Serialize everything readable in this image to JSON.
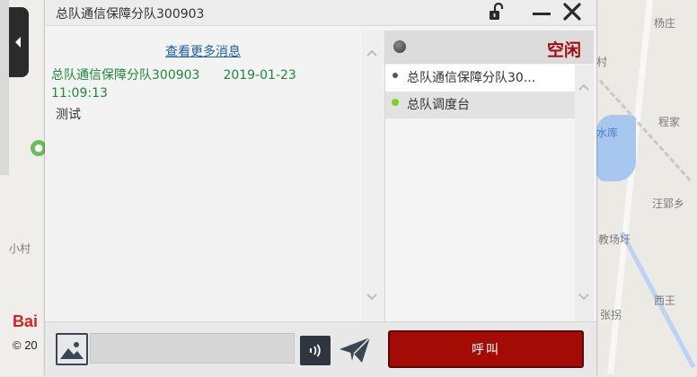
{
  "map": {
    "labels": [
      {
        "name": "map-label-yangzhuang",
        "text": "杨庄"
      },
      {
        "name": "map-label-cun",
        "text": "村"
      },
      {
        "name": "map-label-chengjia",
        "text": "程家"
      },
      {
        "name": "map-label-shuiku",
        "text": "水库"
      },
      {
        "name": "map-label-wangyingxiang",
        "text": "汪郢乡"
      },
      {
        "name": "map-label-jiaochangyu",
        "text": "教场圩"
      },
      {
        "name": "map-label-xiwang",
        "text": "西王"
      },
      {
        "name": "map-label-zhangguai",
        "text": "张拐"
      },
      {
        "name": "map-label-xiaocun",
        "text": "小村"
      }
    ],
    "logo": "Bai",
    "copyright": "© 20",
    "colors": {
      "water": "#a7c7ee",
      "logo": "#d9201f"
    }
  },
  "window": {
    "title": "总队通信保障分队300903",
    "icons": [
      "unlock-icon",
      "minimize-icon",
      "close-icon"
    ]
  },
  "messages": {
    "more_link": "查看更多消息",
    "items": [
      {
        "sender": "总队通信保障分队300903",
        "date": "2019-01-23",
        "time": "11:09:13",
        "text": "测试"
      }
    ]
  },
  "members": {
    "status_label": "空闲",
    "items": [
      {
        "name": "总队通信保障分队30...",
        "status_color": "#555555"
      },
      {
        "name": "总队调度台",
        "status_color": "#7ed321"
      }
    ]
  },
  "composer": {
    "input_value": "",
    "call_label": "呼叫",
    "colors": {
      "call_button": "#a30b05",
      "status_text": "#a00d0d",
      "sender_text": "#1e8a3c"
    }
  }
}
